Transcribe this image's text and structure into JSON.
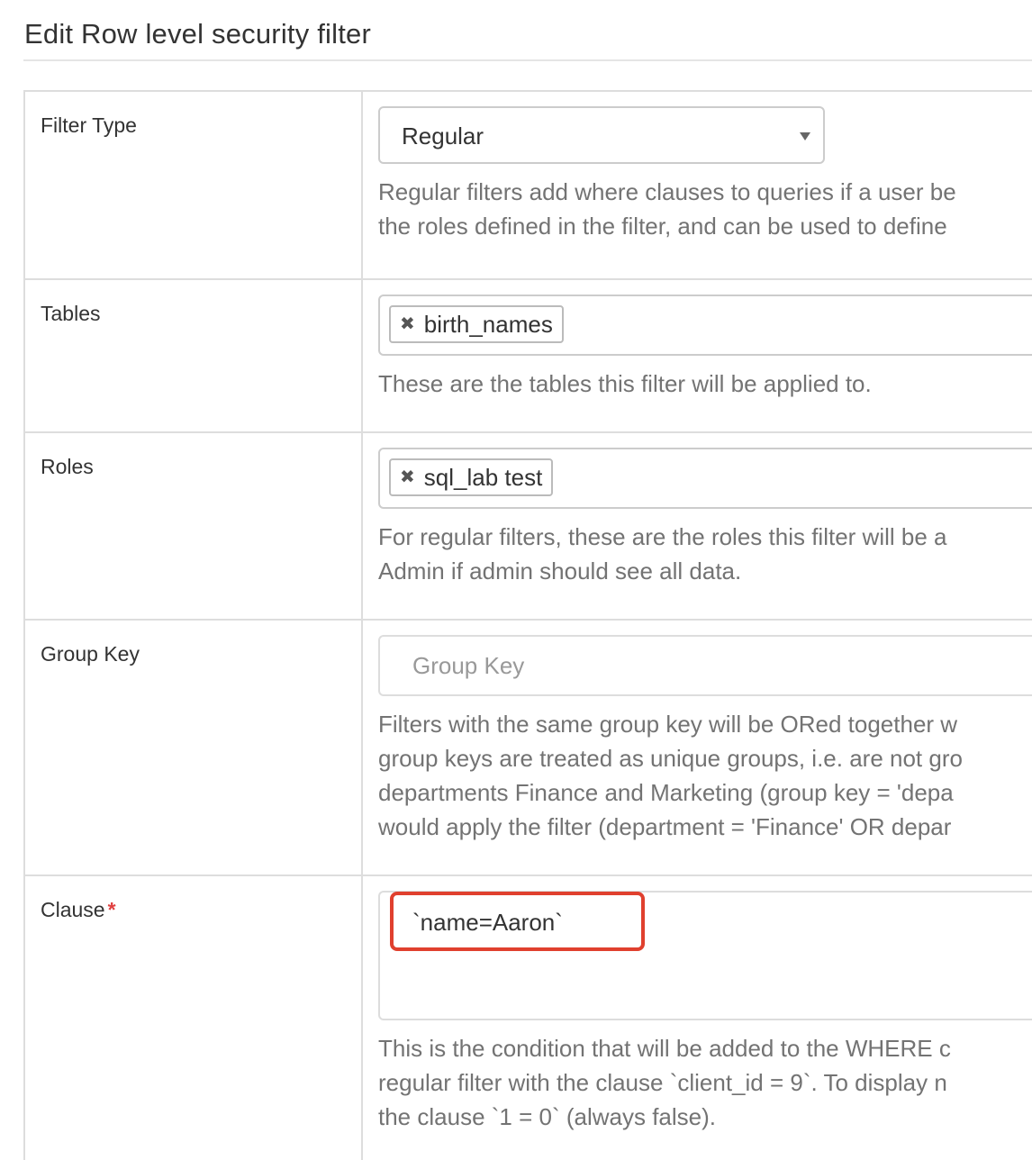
{
  "page": {
    "title": "Edit Row level security filter"
  },
  "form": {
    "filter_type": {
      "label": "Filter Type",
      "value": "Regular",
      "help": [
        "Regular filters add where clauses to queries if a user be",
        "the roles defined in the filter, and can be used to define"
      ]
    },
    "tables": {
      "label": "Tables",
      "chips": [
        "birth_names"
      ],
      "help": [
        "These are the tables this filter will be applied to."
      ]
    },
    "roles": {
      "label": "Roles",
      "chips": [
        "sql_lab test"
      ],
      "help": [
        "For regular filters, these are the roles this filter will be a",
        "Admin if admin should see all data."
      ]
    },
    "group_key": {
      "label": "Group Key",
      "placeholder": "Group Key",
      "help": [
        "Filters with the same group key will be ORed together w",
        "group keys are treated as unique groups, i.e. are not gro",
        "departments Finance and Marketing (group key = 'depa",
        "would apply the filter (department = 'Finance' OR depar"
      ]
    },
    "clause": {
      "label": "Clause",
      "required_marker": "*",
      "value": "`name=Aaron`",
      "highlight_color": "#e0402e",
      "help": [
        "This is the condition that will be added to the WHERE c",
        "regular filter with the clause `client_id = 9`. To display n",
        "the clause `1 = 0` (always false)."
      ]
    }
  },
  "icons": {
    "chip_remove": "close-icon",
    "select_caret": "caret-down-icon"
  },
  "glyphs": {
    "chip_remove": "✖"
  }
}
